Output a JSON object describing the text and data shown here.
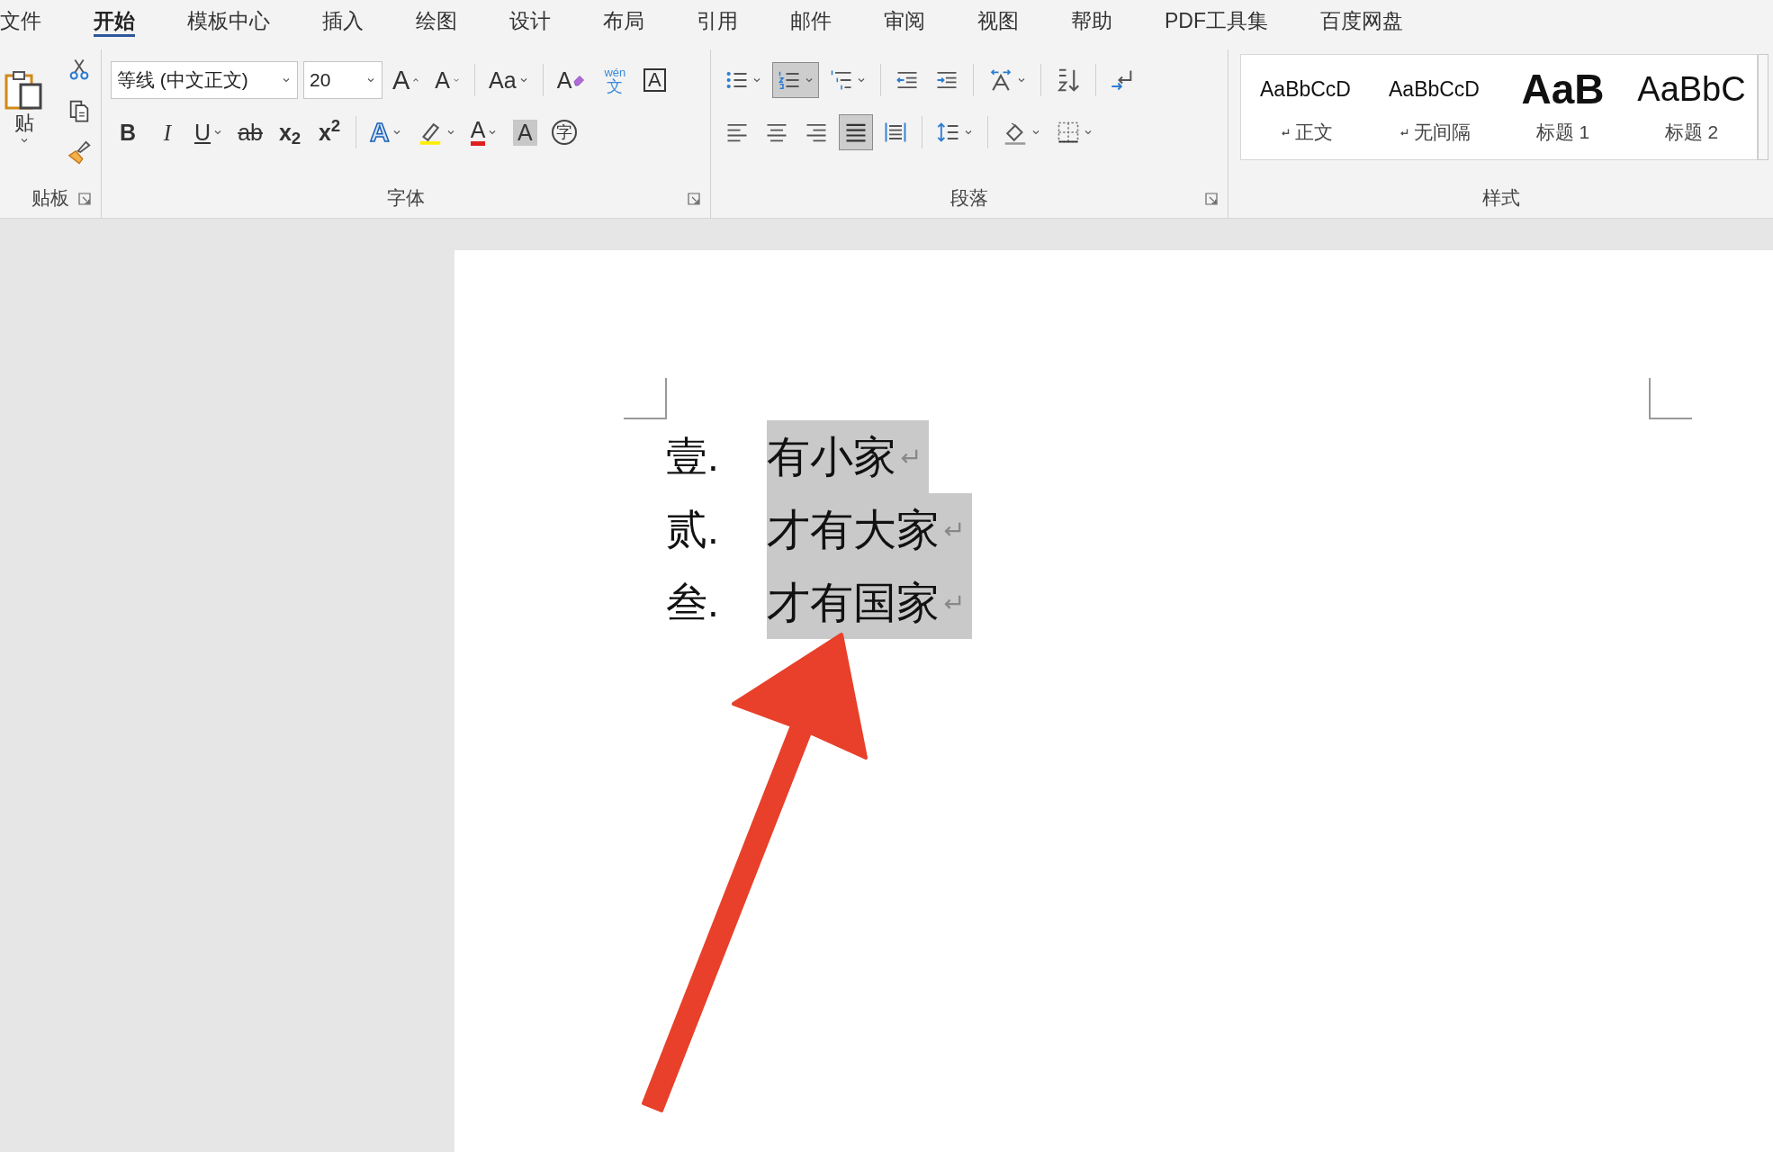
{
  "tabs": [
    {
      "label": "文件",
      "selected": false
    },
    {
      "label": "开始",
      "selected": true
    },
    {
      "label": "模板中心",
      "selected": false
    },
    {
      "label": "插入",
      "selected": false
    },
    {
      "label": "绘图",
      "selected": false
    },
    {
      "label": "设计",
      "selected": false
    },
    {
      "label": "布局",
      "selected": false
    },
    {
      "label": "引用",
      "selected": false
    },
    {
      "label": "邮件",
      "selected": false
    },
    {
      "label": "审阅",
      "selected": false
    },
    {
      "label": "视图",
      "selected": false
    },
    {
      "label": "帮助",
      "selected": false
    },
    {
      "label": "PDF工具集",
      "selected": false
    },
    {
      "label": "百度网盘",
      "selected": false
    }
  ],
  "clipboard": {
    "paste_label": "贴",
    "group_label": "贴板"
  },
  "font": {
    "group_label": "字体",
    "font_name": "等线 (中文正文)",
    "font_size": "20",
    "row1": [
      [
        {
          "kind": "grow",
          "glyph": "A",
          "dropdown": false
        },
        {
          "kind": "shrink",
          "glyph": "A",
          "dropdown": false
        }
      ],
      [
        {
          "kind": "case",
          "glyph": "Aa",
          "dropdown": true
        }
      ],
      [
        {
          "kind": "clear",
          "glyph": "A",
          "dropdown": false
        },
        {
          "kind": "phonetic",
          "glyph": "文",
          "ruby": "wén",
          "dropdown": false
        },
        {
          "kind": "char_border",
          "glyph": "A",
          "dropdown": false
        }
      ]
    ],
    "row2": [
      [
        {
          "kind": "bold",
          "glyph": "B",
          "dropdown": false
        },
        {
          "kind": "italic",
          "glyph": "I",
          "dropdown": false
        },
        {
          "kind": "underline",
          "glyph": "U",
          "dropdown": true
        },
        {
          "kind": "strike",
          "glyph": "ab",
          "dropdown": false
        },
        {
          "kind": "plain",
          "glyph": "x$_{2}$",
          "dropdown": false
        },
        {
          "kind": "plain",
          "glyph": "x$^{2}$",
          "dropdown": false
        }
      ],
      [
        {
          "kind": "effect",
          "glyph": "A",
          "dropdown": true
        },
        {
          "kind": "highlight",
          "color": "#ffee00",
          "dropdown": true
        },
        {
          "kind": "color",
          "glyph": "A",
          "color": "#e02020",
          "dropdown": true
        },
        {
          "kind": "shading",
          "glyph": "A",
          "dropdown": false
        },
        {
          "kind": "enclose",
          "glyph": "字",
          "dropdown": false
        }
      ]
    ]
  },
  "paragraph": {
    "group_label": "段落",
    "row1": [
      [
        {
          "kind": "bullets",
          "dropdown": true,
          "selected": false
        },
        {
          "kind": "numbering",
          "dropdown": true,
          "selected": true
        },
        {
          "kind": "multilevel",
          "dropdown": true,
          "selected": false
        }
      ],
      [
        {
          "kind": "outdent",
          "dropdown": false,
          "selected": false
        },
        {
          "kind": "indent",
          "dropdown": false,
          "selected": false
        }
      ],
      [
        {
          "kind": "asian",
          "dropdown": true,
          "selected": false
        }
      ],
      [
        {
          "kind": "sort",
          "dropdown": false,
          "selected": false
        }
      ],
      [
        {
          "kind": "marks",
          "dropdown": false,
          "selected": false
        }
      ]
    ],
    "row2": [
      [
        {
          "kind": "left",
          "dropdown": false,
          "selected": false
        },
        {
          "kind": "center",
          "dropdown": false,
          "selected": false
        },
        {
          "kind": "right",
          "dropdown": false,
          "selected": false
        },
        {
          "kind": "justify",
          "dropdown": false,
          "selected": true
        },
        {
          "kind": "distribute",
          "dropdown": false,
          "selected": false
        }
      ],
      [
        {
          "kind": "spacing",
          "dropdown": true,
          "selected": false
        }
      ],
      [
        {
          "kind": "fill",
          "dropdown": true,
          "selected": false
        },
        {
          "kind": "borders",
          "dropdown": true,
          "selected": false
        }
      ]
    ]
  },
  "styles": {
    "group_label": "样式",
    "items": [
      {
        "preview": "AaBbCcD",
        "name": "正文",
        "kind": "normal",
        "mark": true
      },
      {
        "preview": "AaBbCcD",
        "name": "无间隔",
        "kind": "normal",
        "mark": true
      },
      {
        "preview": "AaB",
        "name": "标题 1",
        "kind": "heading1",
        "mark": false
      },
      {
        "preview": "AaBbC",
        "name": "标题 2",
        "kind": "heading2",
        "mark": false
      }
    ]
  },
  "document": {
    "items": [
      {
        "number": "壹.",
        "text": "有小家",
        "selected": true
      },
      {
        "number": "贰.",
        "text": "才有大家",
        "selected": true
      },
      {
        "number": "叁.",
        "text": "才有国家",
        "selected": true
      }
    ]
  }
}
